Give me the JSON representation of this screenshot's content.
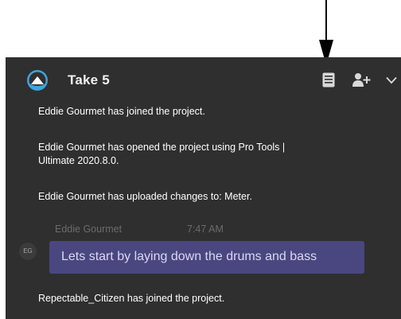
{
  "header": {
    "title": "Take 5",
    "icons": [
      "pro-tools-logo-icon",
      "notes-icon",
      "add-user-icon",
      "chevron-down-icon"
    ]
  },
  "messages": {
    "system_1": "Eddie Gourmet has joined the project.",
    "system_2": "Eddie Gourmet has opened the project using Pro Tools | Ultimate 2020.8.0.",
    "system_3": "Eddie Gourmet has uploaded changes to: Meter.",
    "system_4": "Repectable_Citizen has joined the project."
  },
  "chat": {
    "sender": "Eddie Gourmet",
    "time": "7:47 AM",
    "avatar_initials": "EG",
    "text": "Lets start by laying down the drums and bass"
  },
  "colors": {
    "panel_bg": "#2f2f2f",
    "bubble_bg": "#4a4780",
    "meta_text": "#6b6b6b",
    "logo_blue": "#3ea3dc"
  }
}
